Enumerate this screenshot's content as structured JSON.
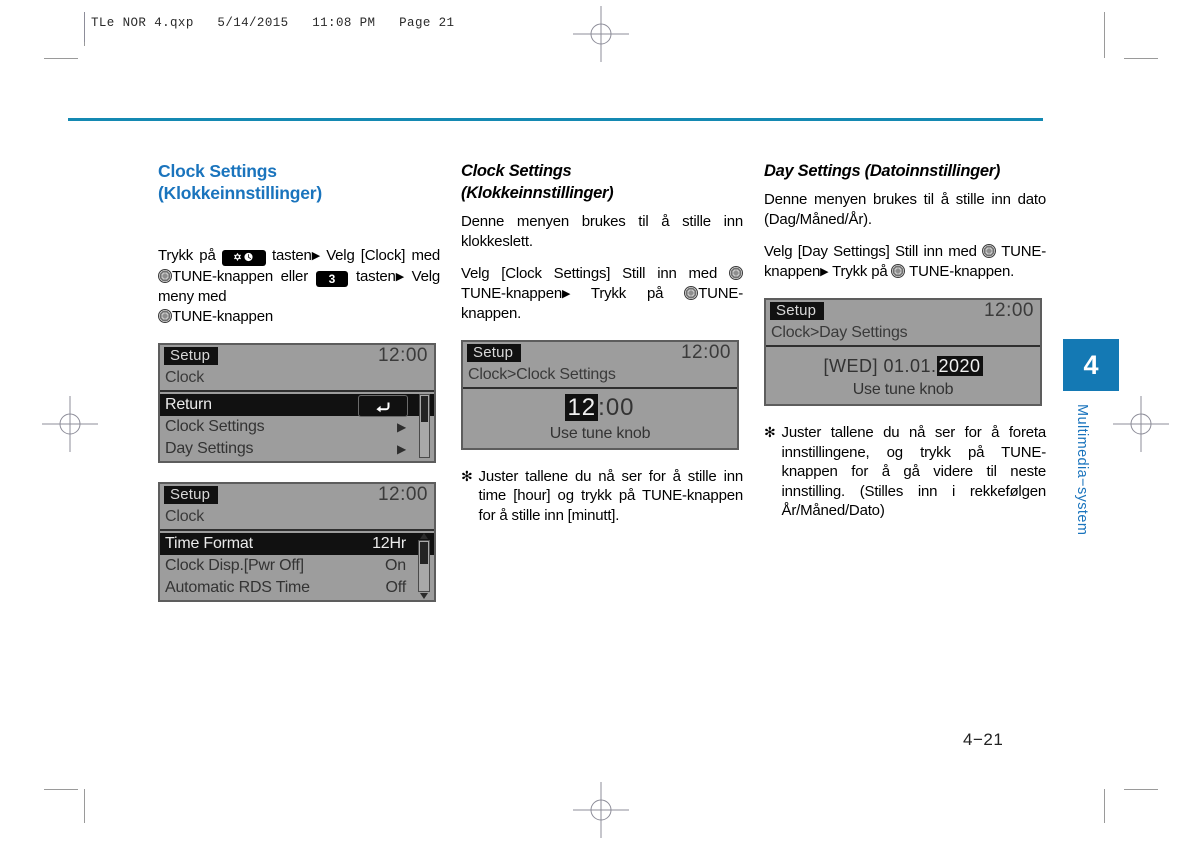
{
  "header": {
    "slug": "TLe NOR 4.qxp   5/14/2015   11:08 PM   Page 21"
  },
  "colors": {
    "accent_blue": "#1a74bd",
    "rule_teal": "#1489b2",
    "tab_blue": "#1479b4",
    "lcd_bg": "#9d9d9d",
    "lcd_dark": "#111111"
  },
  "col1": {
    "heading_line1": "Clock Settings",
    "heading_line2": "(Klokkeinnstillinger)",
    "para_1": "Trykk   på",
    "para_2": "tasten",
    "para_3": "Velg [Clock] med",
    "para_4": "TUNE-knappen eller",
    "para_5": "tasten",
    "para_6": "Velg    meny    med",
    "para_7": "TUNE-knappen",
    "key_setup_clock": "gear-clock-key",
    "key_three": "3",
    "lcd1": {
      "title": "Setup",
      "clock": "12:00",
      "breadcrumb": "Clock",
      "rows": [
        {
          "label": "Return",
          "value": "",
          "selected": true,
          "chevron": false,
          "return_icon": true
        },
        {
          "label": "Clock Settings",
          "value": "",
          "selected": false,
          "chevron": true
        },
        {
          "label": "Day Settings",
          "value": "",
          "selected": false,
          "chevron": true
        }
      ]
    },
    "lcd2": {
      "title": "Setup",
      "clock": "12:00",
      "breadcrumb": "Clock",
      "rows": [
        {
          "label": "Time Format",
          "value": "12Hr",
          "selected": true,
          "value_boxed": true
        },
        {
          "label": "Clock Disp.[Pwr Off]",
          "value": "On",
          "selected": false
        },
        {
          "label": "Automatic RDS Time",
          "value": "Off",
          "selected": false
        }
      ]
    }
  },
  "col2": {
    "heading_line1": "Clock Settings",
    "heading_line2": "(Klokkeinnstillinger)",
    "para_1": "Denne menyen brukes til å stille inn klokkeslett.",
    "para_2a": "Velg [Clock Settings] Still inn med",
    "para_2b": "TUNE-knappen",
    "para_2c": "Trykk  på",
    "para_2d": "TUNE-knappen.",
    "lcd": {
      "title": "Setup",
      "clock": "12:00",
      "breadcrumb": "Clock>Clock Settings",
      "time_hour": "12",
      "time_sep": ":",
      "time_minute": "00",
      "hint": "Use tune knob"
    },
    "note": {
      "star": "✻",
      "text": "Juster tallene du nå ser for å stille inn time [hour] og trykk på TUNE-knappen for å stille inn [minutt]."
    }
  },
  "col3": {
    "heading": "Day Settings (Datoinnstillinger)",
    "para_1": "Denne menyen brukes til å stille inn dato (Dag/Måned/År).",
    "para_2a": "Velg [Day Settings] Still inn med",
    "para_2b": "TUNE-knappen",
    "para_2c": "Trykk på",
    "para_2d": "TUNE-knappen.",
    "lcd": {
      "title": "Setup",
      "clock": "12:00",
      "breadcrumb": "Clock>Day Settings",
      "date_prefix": "[WED] 01.01.",
      "date_year": "2020",
      "hint": "Use tune knob"
    },
    "note": {
      "star": "✻",
      "text": "Juster tallene du nå ser for å foreta innstillingene, og trykk på TUNE-knappen for å gå videre til neste innstilling. (Stilles inn i rekkefølgen År/Måned/Dato)"
    }
  },
  "sidetab": {
    "number": "4",
    "label": "Multimedia−system"
  },
  "footer": {
    "page_number": "4−21"
  }
}
